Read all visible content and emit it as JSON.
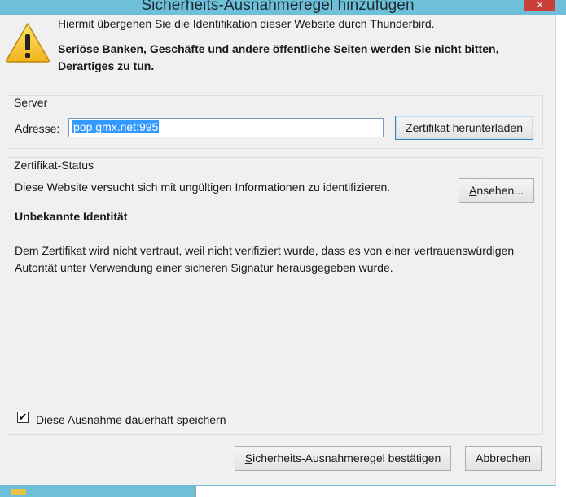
{
  "window": {
    "title": "Sicherheits-Ausnahmeregel hinzufügen",
    "close_glyph": "×"
  },
  "warning": {
    "line1": "Hiermit übergehen Sie die Identifikation dieser Website durch Thunderbird.",
    "line2": "Seriöse Banken, Geschäfte und andere öffentliche Seiten werden Sie nicht bitten, Derartiges zu tun.",
    "icon": "warning-icon"
  },
  "server": {
    "legend": "Server",
    "address_label": "Adresse:",
    "address_value": "pop.gmx.net:995",
    "download_button": {
      "mnemonic": "Z",
      "rest": "ertifikat herunterladen"
    }
  },
  "status": {
    "legend": "Zertifikat-Status",
    "message": "Diese Website versucht sich mit ungültigen Informationen zu identifizieren.",
    "view_button": {
      "mnemonic": "A",
      "rest": "nsehen..."
    },
    "heading": "Unbekannte Identität",
    "description": "Dem Zertifikat wird nicht vertraut, weil nicht verifiziert wurde, dass es von einer vertrauenswürdigen Autorität unter Verwendung einer sicheren Signatur herausgegeben wurde."
  },
  "permanent": {
    "checked": true,
    "check_glyph": "✔",
    "label_pre": "Diese Aus",
    "label_mnemonic": "n",
    "label_post": "ahme dauerhaft speichern"
  },
  "buttons": {
    "confirm": {
      "mnemonic": "S",
      "rest": "icherheits-Ausnahmeregel bestätigen"
    },
    "cancel": "Abbrechen"
  },
  "colors": {
    "frame": "#6ec0d9",
    "dialog_bg": "#f0f0f0",
    "selection": "#3399ff",
    "close_button": "#c7413a"
  }
}
